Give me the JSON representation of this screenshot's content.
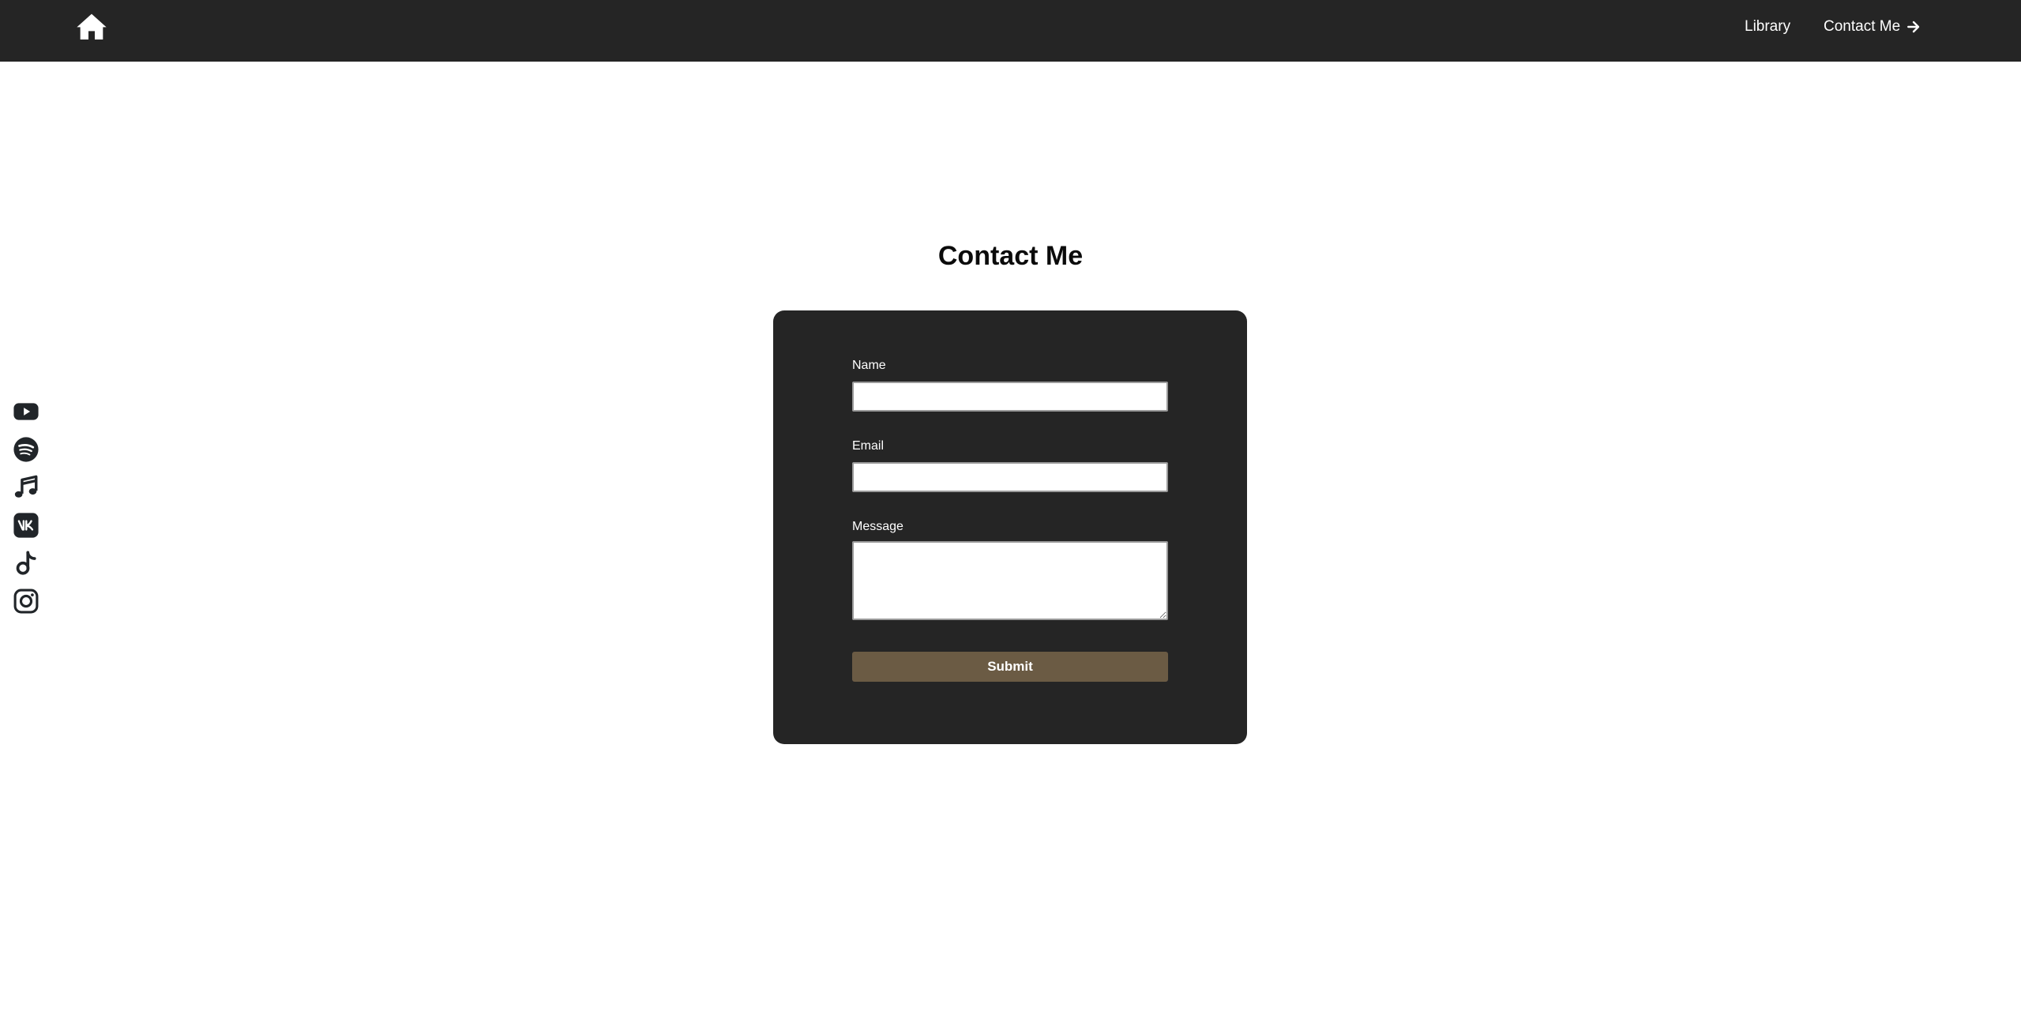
{
  "navbar": {
    "home_icon": "home-icon",
    "links": [
      {
        "label": "Library"
      },
      {
        "label": "Contact Me",
        "icon": "arrow-right-icon"
      }
    ],
    "background": "#252525"
  },
  "social": [
    {
      "icon": "youtube-icon"
    },
    {
      "icon": "spotify-icon"
    },
    {
      "icon": "music-note-icon"
    },
    {
      "icon": "vk-icon"
    },
    {
      "icon": "tiktok-icon"
    },
    {
      "icon": "instagram-icon"
    }
  ],
  "page": {
    "title": "Contact Me"
  },
  "form": {
    "name_label": "Name",
    "name_value": "",
    "email_label": "Email",
    "email_value": "",
    "message_label": "Message",
    "message_value": "",
    "submit_label": "Submit",
    "card_color": "#252525",
    "button_color": "#6b5b44"
  }
}
